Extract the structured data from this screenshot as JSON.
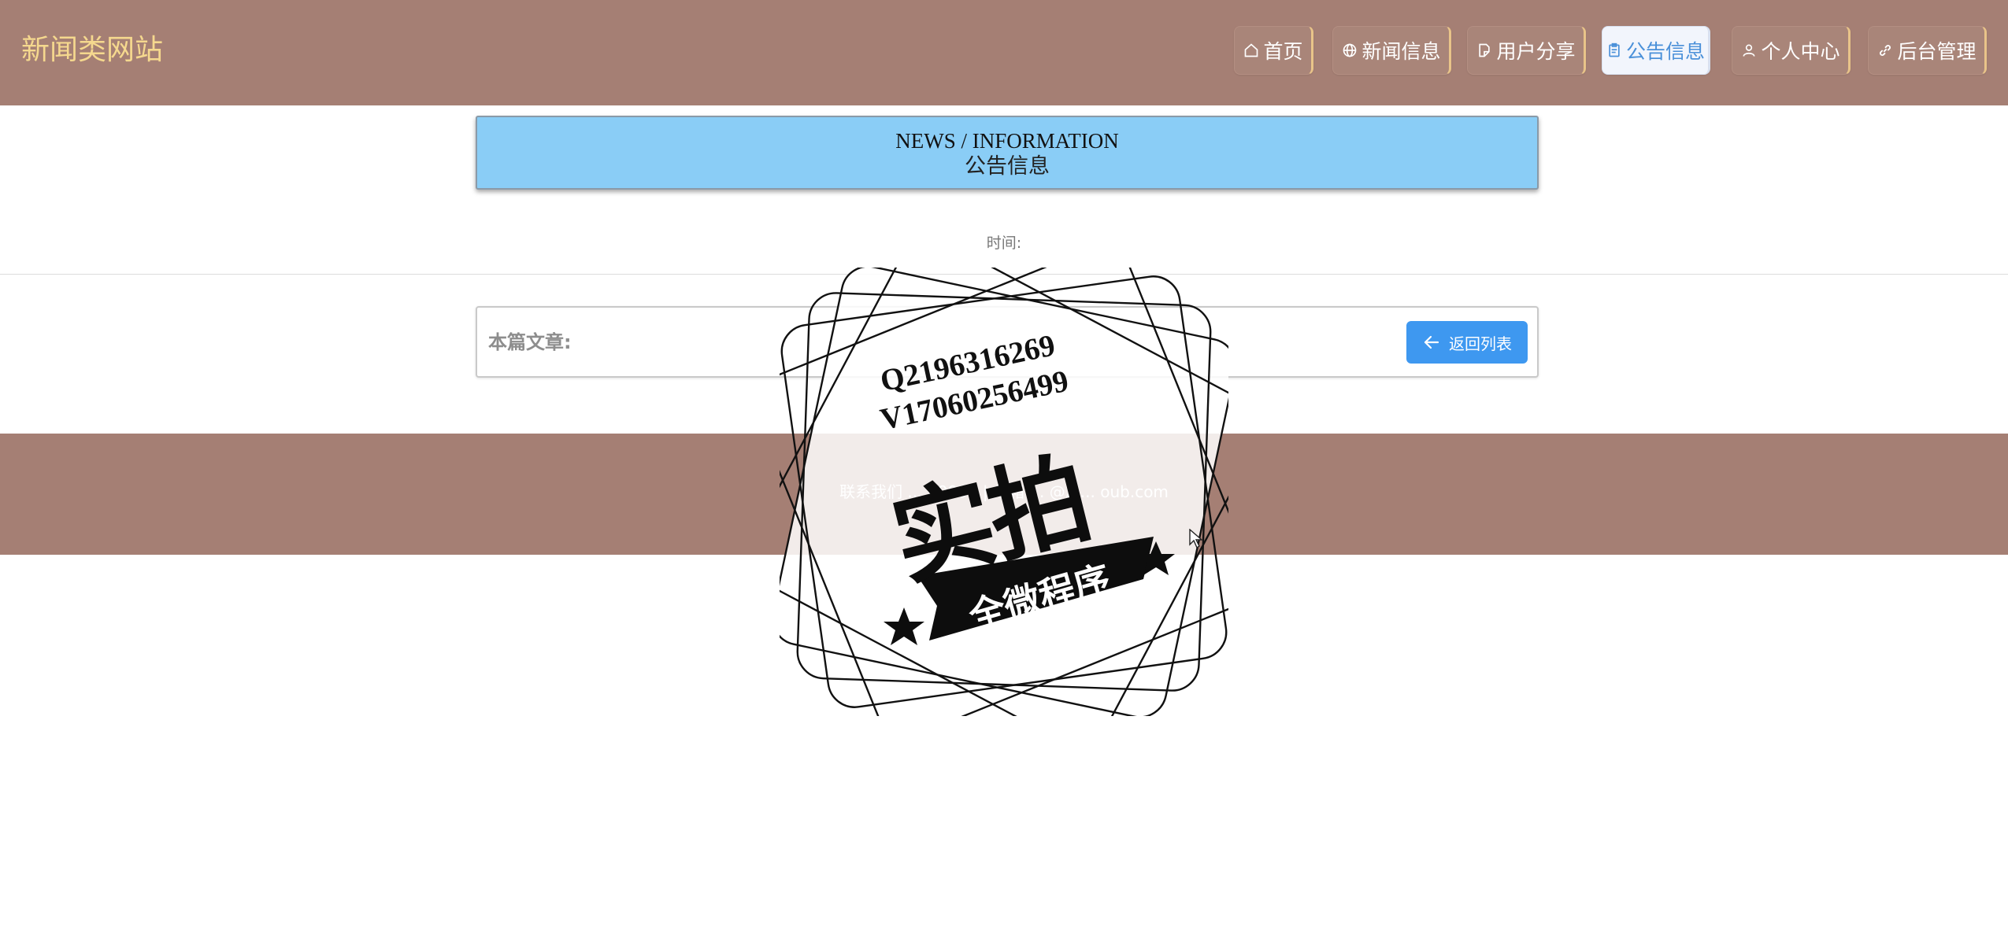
{
  "header": {
    "site_title": "新闻类网站",
    "nav": [
      {
        "label": "首页",
        "icon": "home-icon",
        "active": false
      },
      {
        "label": "新闻信息",
        "icon": "globe-icon",
        "active": false
      },
      {
        "label": "用户分享",
        "icon": "document-icon",
        "active": false
      },
      {
        "label": "公告信息",
        "icon": "clipboard-icon",
        "active": true
      },
      {
        "label": "个人中心",
        "icon": "user-icon",
        "active": false
      },
      {
        "label": "后台管理",
        "icon": "link-icon",
        "active": false
      }
    ]
  },
  "title_box": {
    "english": "NEWS / INFORMATION",
    "chinese": "公告信息"
  },
  "time": {
    "label": "时间:"
  },
  "article": {
    "label": "本篇文章:",
    "back_label": "返回列表"
  },
  "footer": {
    "contact_text": "联系我们 ... 00000 | 邮箱 ... @2 ... oub.com"
  },
  "watermark": {
    "line1": "Q2196316269",
    "line2": "V17060256499",
    "main": "实拍",
    "ribbon": "全微程序"
  },
  "colors": {
    "header_bg": "#a57f74",
    "site_title": "#f5d88e",
    "title_box_bg": "#8acdf6",
    "back_button": "#3e98f0",
    "active_nav_text": "#4a90d9"
  }
}
